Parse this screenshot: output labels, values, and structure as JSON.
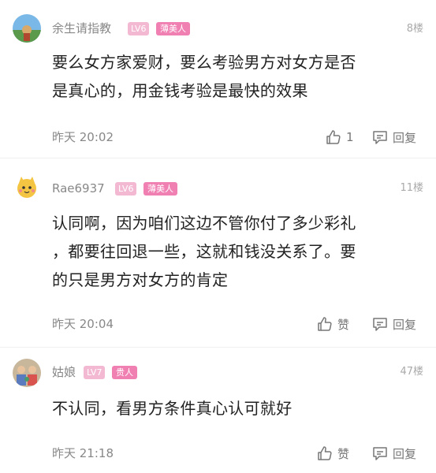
{
  "comments": [
    {
      "username": "余生请指教",
      "level": "LV6",
      "tag": "薄美人",
      "floor": "8楼",
      "text_lines": [
        "要么女方家爱财，要么考验男方对女方是否",
        "是真心的，用金钱考验是最快的效果"
      ],
      "time": "昨天 20:02",
      "like_label": "1",
      "reply_label": "回复"
    },
    {
      "username": "Rae6937",
      "level": "LV6",
      "tag": "薄美人",
      "floor": "11楼",
      "text_lines": [
        "认同啊，因为咱们这边不管你付了多少彩礼",
        "，都要往回退一些，这就和钱没关系了。要",
        "的只是男方对女方的肯定"
      ],
      "time": "昨天 20:04",
      "like_label": "赞",
      "reply_label": "回复"
    },
    {
      "username": "姑娘",
      "level": "LV7",
      "tag": "贵人",
      "floor": "47楼",
      "text_lines": [
        "不认同，看男方条件真心认可就好"
      ],
      "time": "昨天 21:18",
      "like_label": "赞",
      "reply_label": "回复"
    }
  ],
  "colors": {
    "level_badge": "#f3b9d2",
    "tag_badge": "#f07fb2",
    "meta_text": "#888888"
  }
}
